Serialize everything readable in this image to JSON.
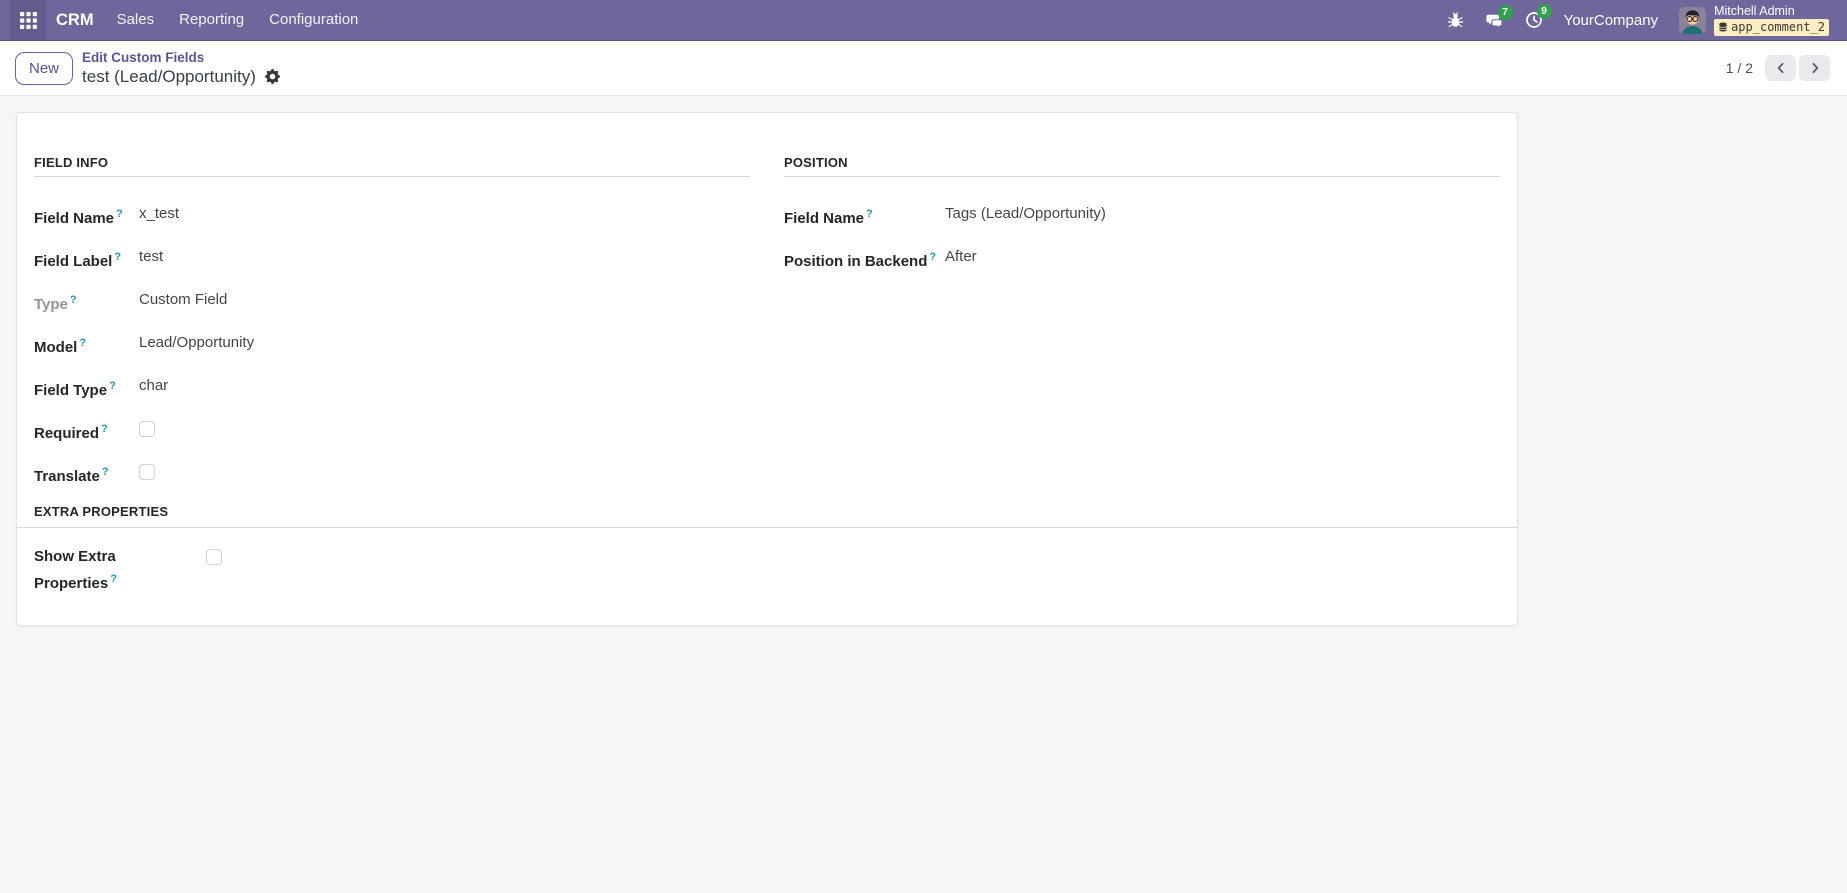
{
  "colors": {
    "navbar_bg": "#6F669B",
    "navbar_border": "#5B527F",
    "accent_purple": "#6C5FA7",
    "breadcrumb_link": "#5D5494",
    "badge_green": "#30A14E",
    "db_badge_bg": "#FCEEC2",
    "help_mark": "#2596B8",
    "content_bg": "#F6F6F7",
    "label_text": "#23272B",
    "value_text": "#41464D"
  },
  "icons": {
    "apps": "grid-icon",
    "debug": "bug-icon",
    "messages": "chat-bubbles-icon",
    "activities": "clock-icon",
    "database": "database-icon",
    "actions": "gear-icon",
    "previous": "chevron-left-icon",
    "next": "chevron-right-icon"
  },
  "navbar": {
    "brand": "CRM",
    "menus": [
      {
        "label": "Sales"
      },
      {
        "label": "Reporting"
      },
      {
        "label": "Configuration"
      }
    ],
    "systray": {
      "messages_count": "7",
      "activities_count": "9",
      "company": "YourCompany",
      "user_name": "Mitchell Admin",
      "db_badge": "app_comment_2"
    }
  },
  "control_panel": {
    "new_button": "New",
    "breadcrumb_parent": "Edit Custom Fields",
    "title": "test (Lead/Opportunity)",
    "pager": "1 / 2"
  },
  "form": {
    "field_info": {
      "title": "FIELD INFO",
      "rows": [
        {
          "label": "Field Name",
          "help": "?",
          "value": "x_test"
        },
        {
          "label": "Field Label",
          "help": "?",
          "value": "test"
        },
        {
          "label": "Type",
          "help": "?",
          "value": "Custom Field"
        },
        {
          "label": "Model",
          "help": "?",
          "value": "Lead/Opportunity"
        },
        {
          "label": "Field Type",
          "help": "?",
          "value": "char"
        },
        {
          "label": "Required",
          "help": "?",
          "checked": false
        },
        {
          "label": "Translate",
          "help": "?",
          "checked": false
        }
      ]
    },
    "position": {
      "title": "POSITION",
      "rows": [
        {
          "label": "Field Name",
          "help": "?",
          "value": "Tags (Lead/Opportunity)"
        },
        {
          "label": "Position in Backend",
          "help": "?",
          "value": "After"
        }
      ]
    },
    "extra_properties": {
      "title": "EXTRA PROPERTIES",
      "rows": [
        {
          "label": "Show Extra Properties",
          "help": "?",
          "checked": false
        }
      ]
    }
  }
}
